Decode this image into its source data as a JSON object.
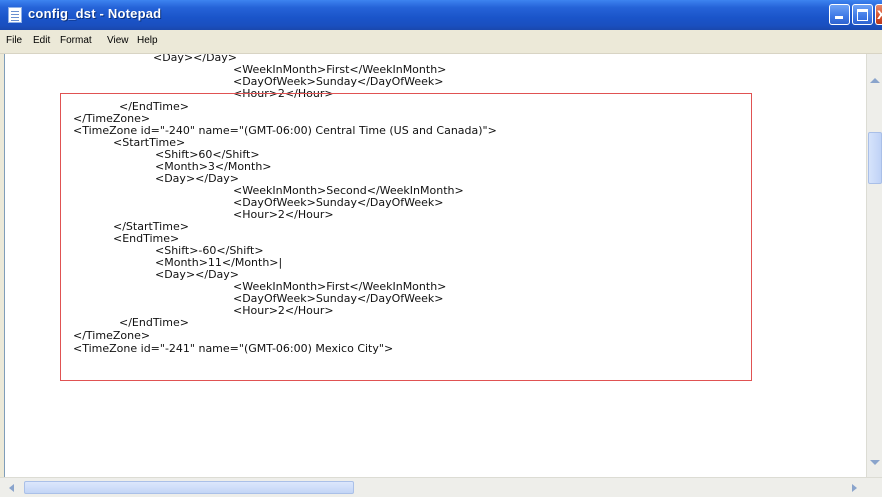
{
  "window": {
    "title": "config_dst - Notepad",
    "controls": {
      "minimize_icon": "minimize-icon",
      "maximize_icon": "maximize-icon",
      "close_glyph": "x"
    }
  },
  "menu": {
    "items": [
      "File",
      "Edit",
      "Format",
      "View",
      "Help"
    ]
  },
  "editor": {
    "lines": [
      "<Day></Day>",
      "<WeekInMonth>First</WeekInMonth>",
      "<DayOfWeek>Sunday</DayOfWeek>",
      "<Hour>2</Hour>",
      "</EndTime>",
      "</TimeZone>",
      "<TimeZone id=\"-240\" name=\"(GMT-06:00) Central Time (US and Canada)\">",
      "<StartTime>",
      "<Shift>60</Shift>",
      "<Month>3</Month>",
      "<Day></Day>",
      "<WeekInMonth>Second</WeekInMonth>",
      "<DayOfWeek>Sunday</DayOfWeek>",
      "<Hour>2</Hour>",
      "</StartTime>",
      "<EndTime>",
      "<Shift>-60</Shift>",
      "<Month>11</Month>|",
      "<Day></Day>",
      "<WeekInMonth>First</WeekInMonth>",
      "<DayOfWeek>Sunday</DayOfWeek>",
      "<Hour>2</Hour>",
      "</EndTime>",
      "</TimeZone>",
      "<TimeZone id=\"-241\" name=\"(GMT-06:00) Mexico City\">"
    ]
  },
  "colors": {
    "title_bar": "#2563d8",
    "highlight_box": "#e05252",
    "chrome": "#ece9d8"
  }
}
